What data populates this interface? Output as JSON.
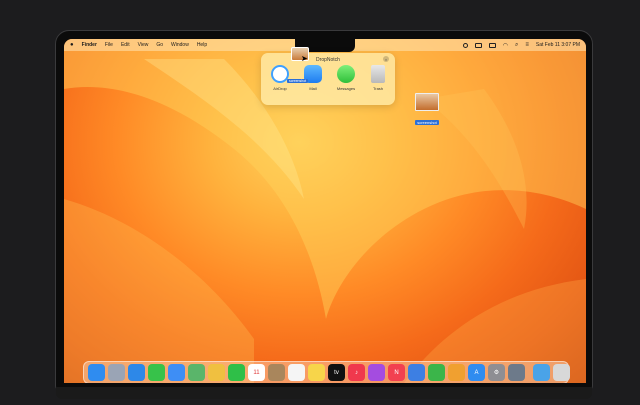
{
  "menubar": {
    "apple": "",
    "menus": [
      "Finder",
      "File",
      "Edit",
      "View",
      "Go",
      "Window",
      "Help"
    ],
    "clock": "Sat Feb 11  3:07 PM"
  },
  "dropnotch": {
    "title": "DropNotch",
    "close": "×",
    "items": [
      {
        "label": "AirDrop",
        "icon": "airdrop-icon"
      },
      {
        "label": "Mail",
        "icon": "mail-icon"
      },
      {
        "label": "Messages",
        "icon": "messages-icon"
      },
      {
        "label": "Trash",
        "icon": "trash-icon"
      }
    ],
    "drag_label": "screenshot"
  },
  "desktop": {
    "file_name": "screenshot"
  },
  "dock": {
    "apps": [
      {
        "name": "finder",
        "color": "#2f8cf0",
        "glyph": ""
      },
      {
        "name": "launchpad",
        "color": "#9aa4b5",
        "glyph": ""
      },
      {
        "name": "safari",
        "color": "#2d88e8",
        "glyph": ""
      },
      {
        "name": "messages",
        "color": "#37c24a",
        "glyph": ""
      },
      {
        "name": "mail",
        "color": "#3e8ef5",
        "glyph": ""
      },
      {
        "name": "maps",
        "color": "#5ab56a",
        "glyph": ""
      },
      {
        "name": "photos",
        "color": "#f0c040",
        "glyph": ""
      },
      {
        "name": "facetime",
        "color": "#2fbf48",
        "glyph": ""
      },
      {
        "name": "calendar",
        "color": "#ffffff",
        "glyph": "11"
      },
      {
        "name": "contacts",
        "color": "#a9865c",
        "glyph": ""
      },
      {
        "name": "reminders",
        "color": "#f5f5f5",
        "glyph": ""
      },
      {
        "name": "notes",
        "color": "#f7d54a",
        "glyph": ""
      },
      {
        "name": "tv",
        "color": "#111111",
        "glyph": "tv"
      },
      {
        "name": "music",
        "color": "#f0384d",
        "glyph": "♪"
      },
      {
        "name": "podcasts",
        "color": "#a44ce0",
        "glyph": ""
      },
      {
        "name": "news",
        "color": "#f24050",
        "glyph": "N"
      },
      {
        "name": "keynote",
        "color": "#3d7fe3",
        "glyph": ""
      },
      {
        "name": "numbers",
        "color": "#3bb54a",
        "glyph": ""
      },
      {
        "name": "pages",
        "color": "#f0a030",
        "glyph": ""
      },
      {
        "name": "app-store",
        "color": "#2f8cf0",
        "glyph": "A"
      },
      {
        "name": "system-settings",
        "color": "#8e8e93",
        "glyph": "⚙"
      },
      {
        "name": "disk-utility",
        "color": "#6d7a8a",
        "glyph": ""
      }
    ],
    "trailing": [
      {
        "name": "downloads",
        "color": "#4aa3e8",
        "glyph": ""
      },
      {
        "name": "trash",
        "color": "#d8d8d8",
        "glyph": ""
      }
    ]
  }
}
